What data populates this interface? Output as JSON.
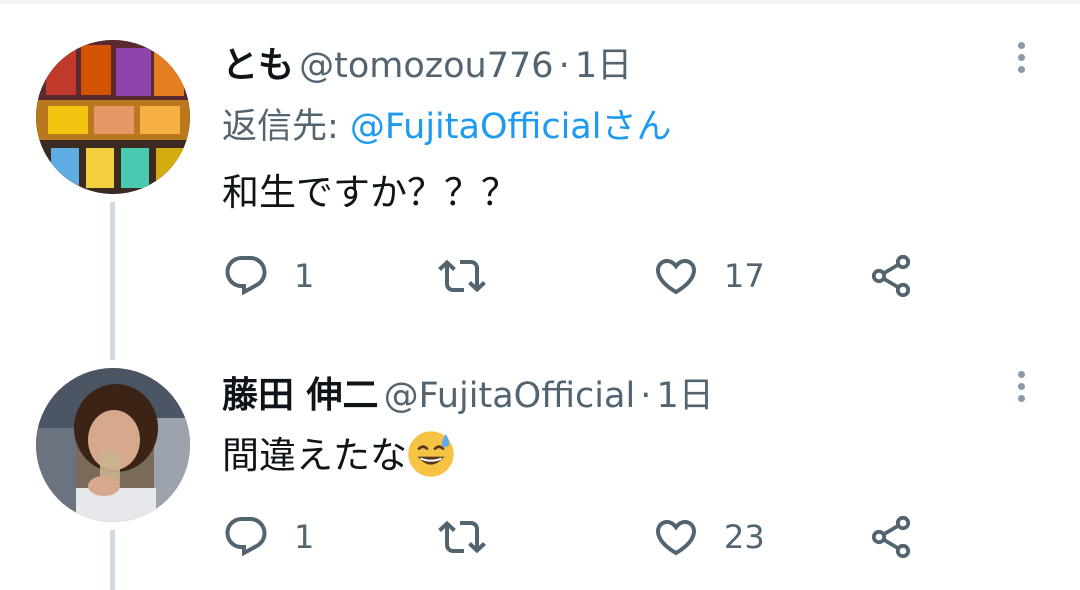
{
  "tweets": [
    {
      "display_name": "とも",
      "handle": "@tomozou776",
      "separator": "·",
      "time": "1日",
      "reply_prefix": "返信先: ",
      "reply_mention": "@FujitaOfficialさん",
      "text": "和生ですか？？？",
      "emoji": "",
      "reply_count": "1",
      "retweet_count": "",
      "like_count": "17",
      "avatar_icon": "pachislot-machine-photo"
    },
    {
      "display_name": "藤田 伸二",
      "handle": "@FujitaOfficial",
      "separator": "·",
      "time": "1日",
      "text": "間違えたな",
      "emoji": "grinning-face-with-sweat",
      "reply_count": "1",
      "retweet_count": "",
      "like_count": "23",
      "avatar_icon": "man-drinking-photo"
    }
  ],
  "colors": {
    "text": "#0f1419",
    "secondary": "#536471",
    "link": "#1d9bf0",
    "icon": "#536471",
    "thread_line": "#cfd9de"
  }
}
